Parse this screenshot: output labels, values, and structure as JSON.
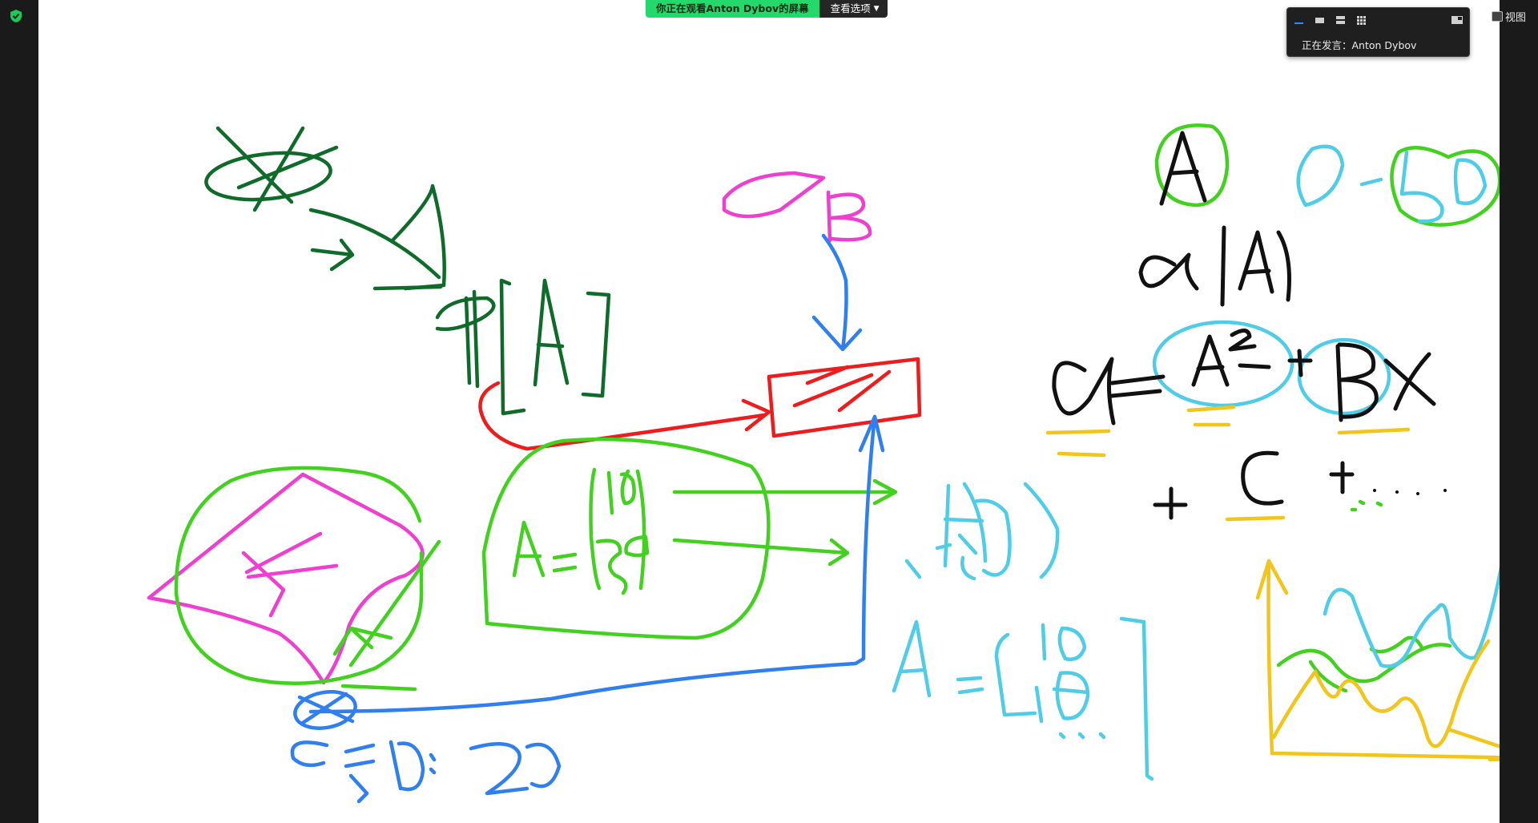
{
  "share_banner": {
    "status": "你正在观看Anton  Dybov的屏幕",
    "options_label": "查看选项",
    "options_icon": "chevron-down-icon",
    "status_color": "#23d96b"
  },
  "speaker_panel": {
    "label": "正在发言：Anton Dybov",
    "layout_icons": [
      "minimize-icon",
      "thumbnail-view-icon",
      "speaker-view-icon",
      "gallery-view-icon",
      "side-by-side-icon"
    ],
    "active_color": "#2d8cff"
  },
  "view_button": {
    "label": "视图"
  },
  "whiteboard": {
    "labels": {
      "A_top": "A",
      "B_pink": "B",
      "range": "0 - 50",
      "alpha_abs": "α |A|",
      "formula_line1": "α = A² + Bx",
      "formula_line2": "+ C + . . . . .",
      "equation_c": "C = 10 : 20",
      "A_matrix_green": "A = 10 20 30",
      "alpha_vector": "α : (x y)",
      "A_matrix_cyan": "A = [10 20 ...]",
      "F_pink": "F",
      "alpha_small": "α"
    },
    "colors": {
      "dark_green": "#0f6b2a",
      "green": "#43d11f",
      "pink": "#ee3fd0",
      "red": "#ee1c1c",
      "blue": "#2f7ff0",
      "cyan": "#4fcde6",
      "black": "#111111",
      "yellow": "#f2c51a"
    }
  }
}
